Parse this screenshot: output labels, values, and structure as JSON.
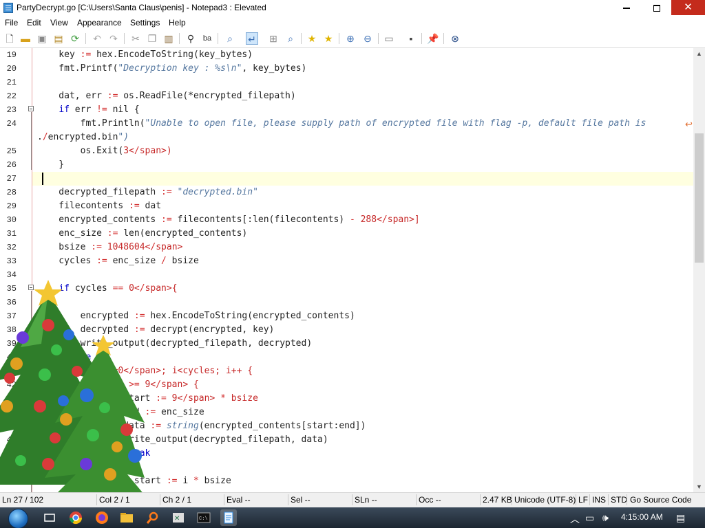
{
  "window": {
    "title": "PartyDecrypt.go [C:\\Users\\Santa Claus\\penis] - Notepad3 : Elevated"
  },
  "menu": [
    "File",
    "Edit",
    "View",
    "Appearance",
    "Settings",
    "Help"
  ],
  "toolbar": {
    "icons": [
      "new-icon",
      "open-icon",
      "save-icon",
      "save-as-icon",
      "reload-icon",
      "undo-icon",
      "redo-icon",
      "cut-icon",
      "copy-icon",
      "paste-icon",
      "find-icon",
      "replace-icon",
      "find-in-files-icon",
      "word-wrap-icon",
      "zoom-fit-icon",
      "zoom-icon",
      "favorites-icon",
      "add-favorite-icon",
      "zoom-in-icon",
      "zoom-out-icon",
      "page-setup-icon",
      "print-icon",
      "pin-icon",
      "close-doc-icon"
    ]
  },
  "editor": {
    "lines": [
      {
        "n": "19",
        "code": "    key := hex.EncodeToString(key_bytes)"
      },
      {
        "n": "20",
        "code": "    fmt.Printf(\"Decryption key : %s\\n\", key_bytes)"
      },
      {
        "n": "21",
        "code": ""
      },
      {
        "n": "22",
        "code": "    dat, err := os.ReadFile(*encrypted_filepath)"
      },
      {
        "n": "23",
        "code": "    if err != nil {"
      },
      {
        "n": "24",
        "code": "        fmt.Println(\"Unable to open file, please supply path of encrypted file with flag -p, default file path is"
      },
      {
        "n": "",
        "code": "./encrypted.bin\")"
      },
      {
        "n": "25",
        "code": "        os.Exit(3)"
      },
      {
        "n": "26",
        "code": "    }"
      },
      {
        "n": "27",
        "code": ""
      },
      {
        "n": "28",
        "code": "    decrypted_filepath := \"decrypted.bin\""
      },
      {
        "n": "29",
        "code": "    filecontents := dat"
      },
      {
        "n": "30",
        "code": "    encrypted_contents := filecontents[:len(filecontents) - 288]"
      },
      {
        "n": "31",
        "code": "    enc_size := len(encrypted_contents)"
      },
      {
        "n": "32",
        "code": "    bsize := 1048604"
      },
      {
        "n": "33",
        "code": "    cycles := enc_size / bsize"
      },
      {
        "n": "34",
        "code": ""
      },
      {
        "n": "35",
        "code": "    if cycles == 0{"
      },
      {
        "n": "36",
        "code": ""
      },
      {
        "n": "37",
        "code": "        encrypted := hex.EncodeToString(encrypted_contents)"
      },
      {
        "n": "38",
        "code": "        decrypted := decrypt(encrypted, key)"
      },
      {
        "n": "39",
        "code": "        write_output(decrypted_filepath, decrypted)"
      },
      {
        "n": "40",
        "code": "    } else {"
      },
      {
        "n": "41",
        "code": "        for i:=0; i<cycles; i++ {"
      },
      {
        "n": "42",
        "code": "            if i >= 9 {"
      },
      {
        "n": "43",
        "code": "                start := 9 * bsize"
      },
      {
        "n": "44",
        "code": "                end := enc_size"
      },
      {
        "n": "45",
        "code": "                data := string(encrypted_contents[start:end])"
      },
      {
        "n": "46",
        "code": "                write_output(decrypted_filepath, data)"
      },
      {
        "n": "47",
        "code": "                break"
      },
      {
        "n": "48",
        "code": "            }"
      },
      {
        "n": "49",
        "code": "            block_start := i * bsize"
      }
    ]
  },
  "status": {
    "ln": "Ln 27 / 102",
    "col": "Col 2 / 1",
    "ch": "Ch 2 / 1",
    "eval": "Eval --",
    "sel": "Sel --",
    "sln": "SLn --",
    "occ": "Occ --",
    "size": "2.47 KB",
    "encoding": "Unicode (UTF-8)",
    "eol": "LF",
    "ins": "INS",
    "std": "STD",
    "lexer": "Go Source Code"
  },
  "taskbar": {
    "apps": [
      "task-view-icon",
      "chrome-icon",
      "firefox-icon",
      "file-explorer-icon",
      "search-icon",
      "excel-icon",
      "console-icon",
      "notepad3-icon"
    ],
    "clock": "4:15:00 AM"
  },
  "colors": {
    "keyword": "#0000c8",
    "string": "#55779f",
    "number": "#c62828",
    "current_line": "#ffffe0",
    "close_button": "#c42b1c"
  }
}
